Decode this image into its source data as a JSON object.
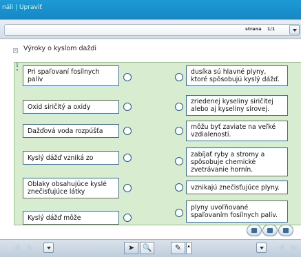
{
  "topbar": {
    "text": "náli | Upraviť"
  },
  "pagination": {
    "label": "strana",
    "value": "1/1"
  },
  "exercise": {
    "title": "Výroky o kyslom daždi",
    "left_items": [
      "Pri spaľovaní fosílnych palív",
      "Oxid siričitý a oxidy",
      "Dažďová voda rozpúšťa",
      "Kyslý dážď vzniká zo",
      "Oblaky obsahujúce kyslé znečisťujúce látky",
      "Kyslý dážď môže"
    ],
    "right_items": [
      "dusíka sú hlavné plyny, ktoré spôsobujú kyslý dážď.",
      "zriedenej kyseliny siričitej alebo aj kyseliny sírovej.",
      "môžu byť zaviate na veľké vzdialenosti.",
      "zabíjať ryby a stromy a spôsobuje chemické zvetrávanie hornín.",
      "vznikajú znečisťujúce plyny.",
      "plyny uvoľňované spaľovaním fosílnych palív."
    ]
  },
  "icons": {
    "title_icon": "collapse-icon",
    "info_icon": "info-icon",
    "panel_buttons": [
      "check-icon",
      "reset-icon",
      "solution-icon"
    ],
    "bottom": [
      "back-arrow-icon",
      "forward-arrow-icon",
      "menu-dropdown-icon",
      "pointer-tool-icon",
      "zoom-tool-icon",
      "pen-tool-icon",
      "pen-options-icon",
      "menu-dropdown-icon",
      "back-arrow-icon",
      "forward-arrow-icon"
    ]
  },
  "colors": {
    "header": "#1a92d0",
    "panel": "#d8edd0",
    "border": "#3d6b8c"
  }
}
